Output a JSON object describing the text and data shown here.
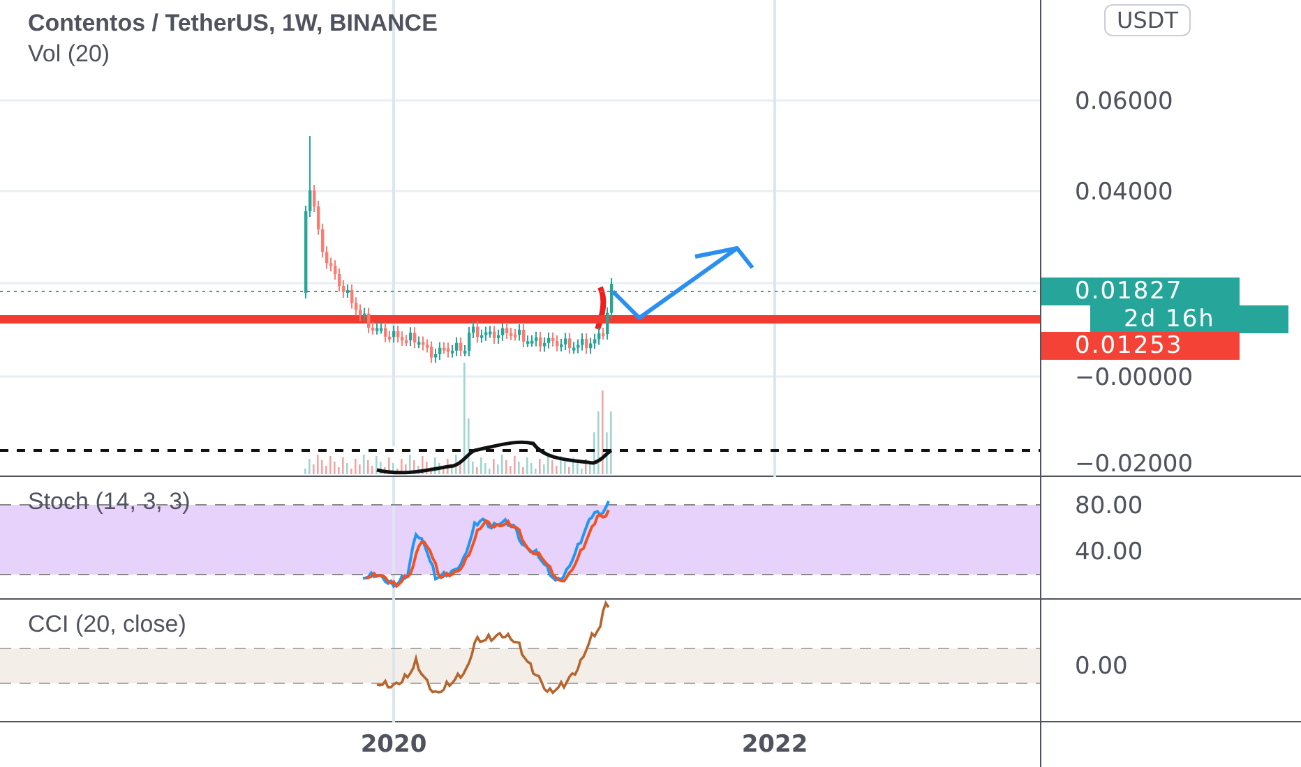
{
  "legend": {
    "title": "Contentos / TetherUS, 1W, BINANCE",
    "volume": "Vol (20)"
  },
  "price_axis": {
    "currency": "USDT",
    "ticks": [
      "0.06000",
      "0.04000",
      "−0.00000",
      "−0.02000"
    ],
    "tags": [
      {
        "text": "0.01827",
        "color": "#26a69a"
      },
      {
        "text": "2d 16h",
        "color": "#26a69a"
      },
      {
        "text": "0.01253",
        "color": "#f44336"
      }
    ]
  },
  "stoch": {
    "label": "Stoch (14, 3, 3)",
    "ticks": [
      "80.00",
      "40.00"
    ]
  },
  "cci": {
    "label": "CCI (20, close)",
    "ticks": [
      "0.00"
    ]
  },
  "time_axis": {
    "labels": [
      "2020",
      "2022"
    ]
  }
}
